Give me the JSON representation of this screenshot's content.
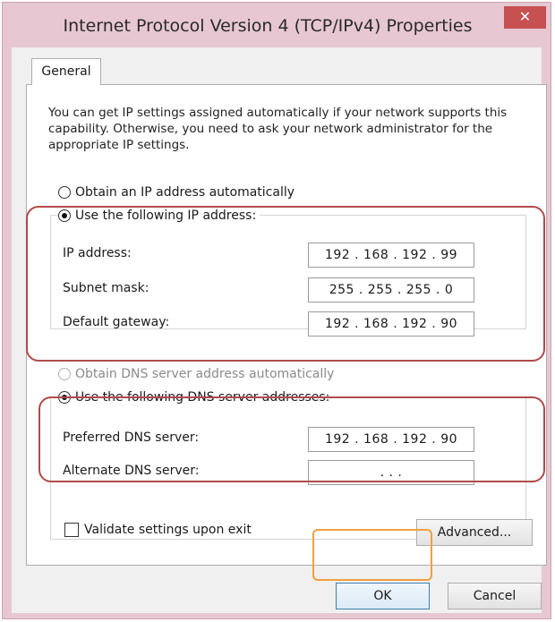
{
  "window": {
    "title": "Internet Protocol Version 4 (TCP/IPv4) Properties",
    "close_label": "✕"
  },
  "tabs": [
    {
      "label": "General"
    }
  ],
  "intro_text": "You can get IP settings assigned automatically if your network supports this capability. Otherwise, you need to ask your network administrator for the appropriate IP settings.",
  "ip": {
    "auto_label": "Obtain an IP address automatically",
    "manual_label": "Use the following IP address:",
    "selected": "manual",
    "fields": [
      {
        "label": "IP address:",
        "value": "192 . 168 . 192 . 99"
      },
      {
        "label": "Subnet mask:",
        "value": "255 . 255 . 255 .  0"
      },
      {
        "label": "Default gateway:",
        "value": "192 . 168 . 192 . 90"
      }
    ]
  },
  "dns": {
    "auto_label": "Obtain DNS server address automatically",
    "manual_label": "Use the following DNS server addresses:",
    "selected": "manual",
    "fields": [
      {
        "label": "Preferred DNS server:",
        "value": "192 . 168 . 192 . 90"
      },
      {
        "label": "Alternate DNS server:",
        "value": ".      .      ."
      }
    ]
  },
  "validate": {
    "label": "Validate settings upon exit",
    "checked": false
  },
  "buttons": {
    "advanced": "Advanced...",
    "ok": "OK",
    "cancel": "Cancel"
  },
  "colors": {
    "annotation_red": "#b04a4a",
    "annotation_orange": "#f0a040",
    "close_red": "#c75050"
  }
}
